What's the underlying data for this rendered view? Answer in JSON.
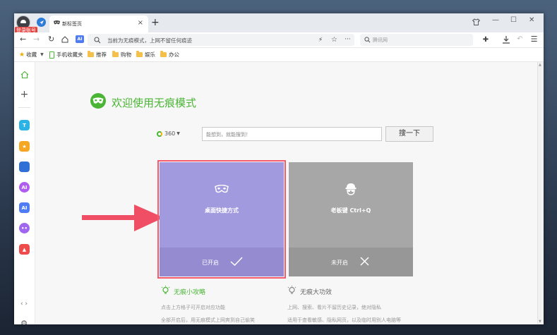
{
  "browser": {
    "login_badge": "登录账号",
    "tab_title": "新标签页",
    "tab_close": "×",
    "new_tab": "+",
    "address_text": "当前为无痕模式，上网不留任何痕迹",
    "search_placeholder": "腾讯网",
    "window_controls": {
      "minimize": "—",
      "maximize": "☐",
      "close": "✕"
    }
  },
  "bookmarks": [
    {
      "label": "收藏",
      "icon": "star-icon"
    },
    {
      "label": "手机收藏夹",
      "icon": "phone-icon"
    },
    {
      "label": "推荐",
      "icon": "folder-icon"
    },
    {
      "label": "购物",
      "icon": "folder-icon"
    },
    {
      "label": "娱乐",
      "icon": "folder-icon"
    },
    {
      "label": "办公",
      "icon": "folder-icon"
    }
  ],
  "sidebar": {
    "apps": [
      {
        "name": "translate-app-icon",
        "color": "#2bb3e6",
        "glyph": "T"
      },
      {
        "name": "star-app-icon",
        "color": "#f5a623",
        "glyph": "★"
      },
      {
        "name": "network-app-icon",
        "color": "#2f6fd6",
        "glyph": ""
      },
      {
        "name": "ai-ring-app-icon",
        "color": "#b05cf0",
        "glyph": "AI"
      },
      {
        "name": "ai-app-icon",
        "color": "#4f7cf5",
        "glyph": "AI"
      },
      {
        "name": "chat-bot-app-icon",
        "color": "#a066f0",
        "glyph": "••"
      },
      {
        "name": "game-app-icon",
        "color": "#ee4b4b",
        "glyph": "▲"
      }
    ]
  },
  "page": {
    "welcome_title": "欢迎使用无痕模式",
    "search": {
      "brand": "360",
      "placeholder": "能想到，就能搜到！",
      "button": "搜一下"
    },
    "cards": [
      {
        "title": "桌面快捷方式",
        "status": "已开启",
        "icon": "mask-icon",
        "status_icon": "check-icon"
      },
      {
        "title": "老板键 Ctrl+Q",
        "status": "未开启",
        "icon": "boss-key-icon",
        "status_icon": "x-icon"
      }
    ],
    "tips": [
      {
        "heading": "无痕小攻略",
        "lines": [
          "点击上方格子可开启对应功能",
          "全部开启后，用无痕模式上网爽到自己偷笑"
        ]
      },
      {
        "heading": "无痕大功效",
        "lines": [
          "上网、搜索、看片不留历史记录，绝对隐私",
          "适用于查看敏感、隐私网页，以及临时用别人电脑等"
        ]
      }
    ]
  },
  "colors": {
    "accent_green": "#4ab534",
    "card_purple": "#a29adf",
    "card_gray": "#a7a7a7",
    "highlight_red": "#f45b6c"
  }
}
